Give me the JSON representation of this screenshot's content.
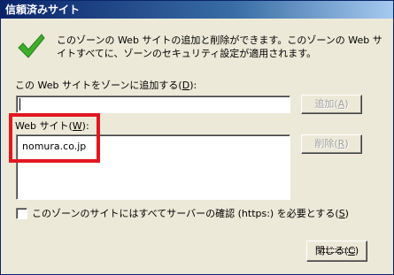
{
  "window": {
    "title": "信頼済みサイト",
    "close_glyph": "×"
  },
  "description": "このゾーンの Web サイトの追加と削除ができます。このゾーンの Web サイトすべてに、ゾーンのセキュリティ設定が適用されます。",
  "add_section": {
    "label_text": "この Web サイトをゾーンに追加する(",
    "label_accel": "D",
    "label_end": "):",
    "input_value": "",
    "add_button_text": "追加(",
    "add_button_accel": "A",
    "add_button_end": ")"
  },
  "list_section": {
    "label_text": "Web サイト(",
    "label_accel": "W",
    "label_end": "):",
    "items": [
      "nomura.co.jp"
    ],
    "remove_button_text": "削除(",
    "remove_button_accel": "R",
    "remove_button_end": ")"
  },
  "https_checkbox": {
    "label_text": "このゾーンのサイトにはすべてサーバーの確認 (https:) を必要とする(",
    "label_accel": "S",
    "label_end": ")",
    "checked": false
  },
  "close_button": {
    "text": "閉じる(",
    "accel": "C",
    "end": ")"
  },
  "colors": {
    "highlight": "#e2171f",
    "check_icon": "#3fae2a"
  }
}
